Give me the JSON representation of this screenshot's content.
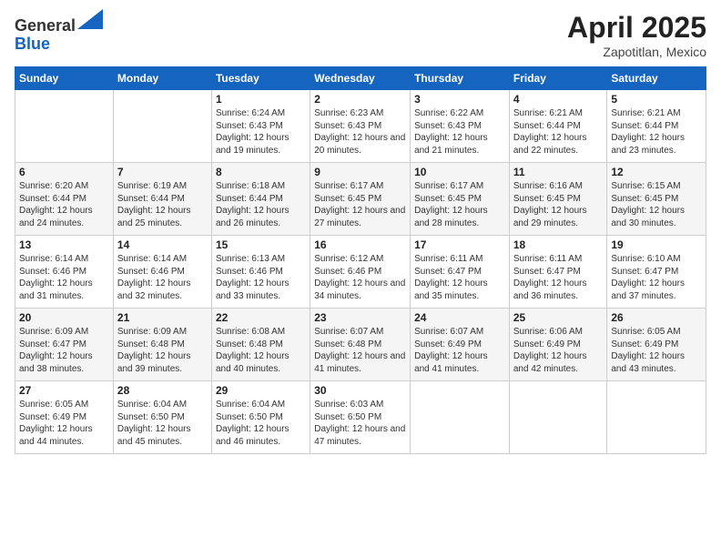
{
  "logo": {
    "general": "General",
    "blue": "Blue"
  },
  "title": {
    "main": "April 2025",
    "sub": "Zapotitlan, Mexico"
  },
  "headers": [
    "Sunday",
    "Monday",
    "Tuesday",
    "Wednesday",
    "Thursday",
    "Friday",
    "Saturday"
  ],
  "weeks": [
    [
      {
        "day": "",
        "info": ""
      },
      {
        "day": "",
        "info": ""
      },
      {
        "day": "1",
        "info": "Sunrise: 6:24 AM\nSunset: 6:43 PM\nDaylight: 12 hours and 19 minutes."
      },
      {
        "day": "2",
        "info": "Sunrise: 6:23 AM\nSunset: 6:43 PM\nDaylight: 12 hours and 20 minutes."
      },
      {
        "day": "3",
        "info": "Sunrise: 6:22 AM\nSunset: 6:43 PM\nDaylight: 12 hours and 21 minutes."
      },
      {
        "day": "4",
        "info": "Sunrise: 6:21 AM\nSunset: 6:44 PM\nDaylight: 12 hours and 22 minutes."
      },
      {
        "day": "5",
        "info": "Sunrise: 6:21 AM\nSunset: 6:44 PM\nDaylight: 12 hours and 23 minutes."
      }
    ],
    [
      {
        "day": "6",
        "info": "Sunrise: 6:20 AM\nSunset: 6:44 PM\nDaylight: 12 hours and 24 minutes."
      },
      {
        "day": "7",
        "info": "Sunrise: 6:19 AM\nSunset: 6:44 PM\nDaylight: 12 hours and 25 minutes."
      },
      {
        "day": "8",
        "info": "Sunrise: 6:18 AM\nSunset: 6:44 PM\nDaylight: 12 hours and 26 minutes."
      },
      {
        "day": "9",
        "info": "Sunrise: 6:17 AM\nSunset: 6:45 PM\nDaylight: 12 hours and 27 minutes."
      },
      {
        "day": "10",
        "info": "Sunrise: 6:17 AM\nSunset: 6:45 PM\nDaylight: 12 hours and 28 minutes."
      },
      {
        "day": "11",
        "info": "Sunrise: 6:16 AM\nSunset: 6:45 PM\nDaylight: 12 hours and 29 minutes."
      },
      {
        "day": "12",
        "info": "Sunrise: 6:15 AM\nSunset: 6:45 PM\nDaylight: 12 hours and 30 minutes."
      }
    ],
    [
      {
        "day": "13",
        "info": "Sunrise: 6:14 AM\nSunset: 6:46 PM\nDaylight: 12 hours and 31 minutes."
      },
      {
        "day": "14",
        "info": "Sunrise: 6:14 AM\nSunset: 6:46 PM\nDaylight: 12 hours and 32 minutes."
      },
      {
        "day": "15",
        "info": "Sunrise: 6:13 AM\nSunset: 6:46 PM\nDaylight: 12 hours and 33 minutes."
      },
      {
        "day": "16",
        "info": "Sunrise: 6:12 AM\nSunset: 6:46 PM\nDaylight: 12 hours and 34 minutes."
      },
      {
        "day": "17",
        "info": "Sunrise: 6:11 AM\nSunset: 6:47 PM\nDaylight: 12 hours and 35 minutes."
      },
      {
        "day": "18",
        "info": "Sunrise: 6:11 AM\nSunset: 6:47 PM\nDaylight: 12 hours and 36 minutes."
      },
      {
        "day": "19",
        "info": "Sunrise: 6:10 AM\nSunset: 6:47 PM\nDaylight: 12 hours and 37 minutes."
      }
    ],
    [
      {
        "day": "20",
        "info": "Sunrise: 6:09 AM\nSunset: 6:47 PM\nDaylight: 12 hours and 38 minutes."
      },
      {
        "day": "21",
        "info": "Sunrise: 6:09 AM\nSunset: 6:48 PM\nDaylight: 12 hours and 39 minutes."
      },
      {
        "day": "22",
        "info": "Sunrise: 6:08 AM\nSunset: 6:48 PM\nDaylight: 12 hours and 40 minutes."
      },
      {
        "day": "23",
        "info": "Sunrise: 6:07 AM\nSunset: 6:48 PM\nDaylight: 12 hours and 41 minutes."
      },
      {
        "day": "24",
        "info": "Sunrise: 6:07 AM\nSunset: 6:49 PM\nDaylight: 12 hours and 41 minutes."
      },
      {
        "day": "25",
        "info": "Sunrise: 6:06 AM\nSunset: 6:49 PM\nDaylight: 12 hours and 42 minutes."
      },
      {
        "day": "26",
        "info": "Sunrise: 6:05 AM\nSunset: 6:49 PM\nDaylight: 12 hours and 43 minutes."
      }
    ],
    [
      {
        "day": "27",
        "info": "Sunrise: 6:05 AM\nSunset: 6:49 PM\nDaylight: 12 hours and 44 minutes."
      },
      {
        "day": "28",
        "info": "Sunrise: 6:04 AM\nSunset: 6:50 PM\nDaylight: 12 hours and 45 minutes."
      },
      {
        "day": "29",
        "info": "Sunrise: 6:04 AM\nSunset: 6:50 PM\nDaylight: 12 hours and 46 minutes."
      },
      {
        "day": "30",
        "info": "Sunrise: 6:03 AM\nSunset: 6:50 PM\nDaylight: 12 hours and 47 minutes."
      },
      {
        "day": "",
        "info": ""
      },
      {
        "day": "",
        "info": ""
      },
      {
        "day": "",
        "info": ""
      }
    ]
  ]
}
